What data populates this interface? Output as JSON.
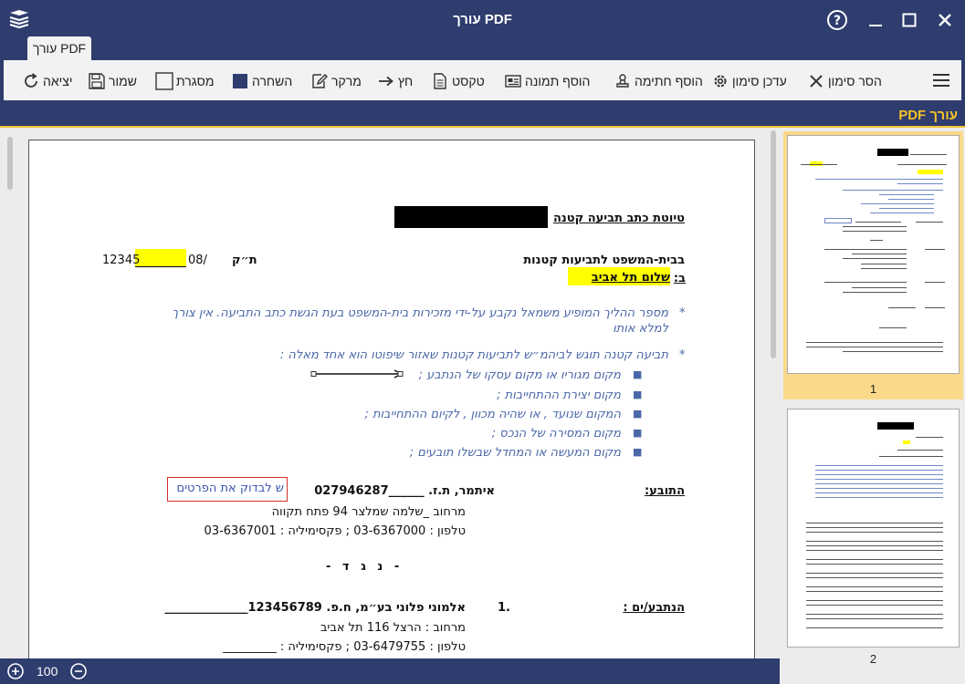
{
  "window": {
    "title": "עורך PDF"
  },
  "ribbon": {
    "tab_label": "עורך PDF"
  },
  "toolbar": {
    "remove_mark": "הסר סימון",
    "mark_settings": "עדכן סימון",
    "add_signature": "הוסף חתימה",
    "add_image": "הוסף תמונה",
    "text": "טקסט",
    "arrow": "חץ",
    "highlighter": "מרקר",
    "blackout": "השחרה",
    "frame": "מסגרת",
    "save": "שמור",
    "exit": "יציאה"
  },
  "section": {
    "title": "עורך PDF"
  },
  "document": {
    "heading": "טיוטת כתב תביעה קטנה",
    "court": "בבית-המשפט לתביעות קטנות",
    "case_prefix": "ת״ק",
    "case_mid": "08/",
    "case_num": "12345",
    "venue_prefix": "ב:",
    "venue_value": "שלום תל אביב",
    "note1_line1": "מספר ההליך המופיע משמאל נקבע על-ידי מזכירות בית-המשפט בעת הגשת כתב התביעה. אין צורך",
    "note1_line2": "למלא אותו",
    "note2": "תביעה קטנה תוגש לביהמ״ש לתביעות קטנות שאזור שיפוטו הוא אחד מאלה :",
    "bullets": [
      "מקום מגוריו או מקום עסקו של הנתבע ;",
      "מקום יצירת ההתחייבות ;",
      "המקום שנועד , או שהיה מכוון , לקיום ההתחייבות ;",
      "מקום המסירה של הנכס ;",
      "מקום המעשה או המחדל שבשלו תובעים ;"
    ],
    "plaintiff_label": "התובע:",
    "plaintiff_name": "איתמר, ת.ז. ______027946287",
    "check_note": "ש לבדוק את הפרטים",
    "plaintiff_addr": "מרחוב _שלמה שמלצר 94 פתח תקווה",
    "plaintiff_phone": "טלפון : 03-6367000 ; פקסימיליה : 03-6367001",
    "versus": "- נ ג ד -",
    "defendants_label": "הנתבע/ים :",
    "def_index": "1.",
    "def_name": "אלמוני פלוני בע״מ, ח.פ. 123456789______________",
    "def_addr": "מרחוב : הרצל 116 תל אביב",
    "def_phone": "טלפון : 03-6479755 ; פקסימיליה : _________"
  },
  "thumbnails": [
    {
      "page": "1",
      "selected": true
    },
    {
      "page": "2",
      "selected": false
    }
  ],
  "status": {
    "zoom": "100"
  },
  "colors": {
    "chrome": "#2e3c6e",
    "accent": "#f7c326",
    "highlight": "#ffff00",
    "selected_thumb": "#fbd98a"
  }
}
